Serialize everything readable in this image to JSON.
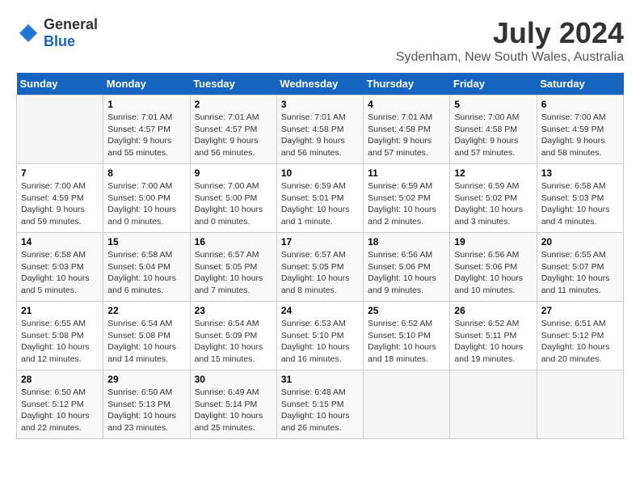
{
  "header": {
    "logo_general": "General",
    "logo_blue": "Blue",
    "title": "July 2024",
    "subtitle": "Sydenham, New South Wales, Australia"
  },
  "calendar": {
    "weekdays": [
      "Sunday",
      "Monday",
      "Tuesday",
      "Wednesday",
      "Thursday",
      "Friday",
      "Saturday"
    ],
    "weeks": [
      [
        {
          "day": "",
          "sunrise": "",
          "sunset": "",
          "daylight": ""
        },
        {
          "day": "1",
          "sunrise": "Sunrise: 7:01 AM",
          "sunset": "Sunset: 4:57 PM",
          "daylight": "Daylight: 9 hours and 55 minutes."
        },
        {
          "day": "2",
          "sunrise": "Sunrise: 7:01 AM",
          "sunset": "Sunset: 4:57 PM",
          "daylight": "Daylight: 9 hours and 56 minutes."
        },
        {
          "day": "3",
          "sunrise": "Sunrise: 7:01 AM",
          "sunset": "Sunset: 4:58 PM",
          "daylight": "Daylight: 9 hours and 56 minutes."
        },
        {
          "day": "4",
          "sunrise": "Sunrise: 7:01 AM",
          "sunset": "Sunset: 4:58 PM",
          "daylight": "Daylight: 9 hours and 57 minutes."
        },
        {
          "day": "5",
          "sunrise": "Sunrise: 7:00 AM",
          "sunset": "Sunset: 4:58 PM",
          "daylight": "Daylight: 9 hours and 57 minutes."
        },
        {
          "day": "6",
          "sunrise": "Sunrise: 7:00 AM",
          "sunset": "Sunset: 4:59 PM",
          "daylight": "Daylight: 9 hours and 58 minutes."
        }
      ],
      [
        {
          "day": "7",
          "sunrise": "Sunrise: 7:00 AM",
          "sunset": "Sunset: 4:59 PM",
          "daylight": "Daylight: 9 hours and 59 minutes."
        },
        {
          "day": "8",
          "sunrise": "Sunrise: 7:00 AM",
          "sunset": "Sunset: 5:00 PM",
          "daylight": "Daylight: 10 hours and 0 minutes."
        },
        {
          "day": "9",
          "sunrise": "Sunrise: 7:00 AM",
          "sunset": "Sunset: 5:00 PM",
          "daylight": "Daylight: 10 hours and 0 minutes."
        },
        {
          "day": "10",
          "sunrise": "Sunrise: 6:59 AM",
          "sunset": "Sunset: 5:01 PM",
          "daylight": "Daylight: 10 hours and 1 minute."
        },
        {
          "day": "11",
          "sunrise": "Sunrise: 6:59 AM",
          "sunset": "Sunset: 5:02 PM",
          "daylight": "Daylight: 10 hours and 2 minutes."
        },
        {
          "day": "12",
          "sunrise": "Sunrise: 6:59 AM",
          "sunset": "Sunset: 5:02 PM",
          "daylight": "Daylight: 10 hours and 3 minutes."
        },
        {
          "day": "13",
          "sunrise": "Sunrise: 6:58 AM",
          "sunset": "Sunset: 5:03 PM",
          "daylight": "Daylight: 10 hours and 4 minutes."
        }
      ],
      [
        {
          "day": "14",
          "sunrise": "Sunrise: 6:58 AM",
          "sunset": "Sunset: 5:03 PM",
          "daylight": "Daylight: 10 hours and 5 minutes."
        },
        {
          "day": "15",
          "sunrise": "Sunrise: 6:58 AM",
          "sunset": "Sunset: 5:04 PM",
          "daylight": "Daylight: 10 hours and 6 minutes."
        },
        {
          "day": "16",
          "sunrise": "Sunrise: 6:57 AM",
          "sunset": "Sunset: 5:05 PM",
          "daylight": "Daylight: 10 hours and 7 minutes."
        },
        {
          "day": "17",
          "sunrise": "Sunrise: 6:57 AM",
          "sunset": "Sunset: 5:05 PM",
          "daylight": "Daylight: 10 hours and 8 minutes."
        },
        {
          "day": "18",
          "sunrise": "Sunrise: 6:56 AM",
          "sunset": "Sunset: 5:06 PM",
          "daylight": "Daylight: 10 hours and 9 minutes."
        },
        {
          "day": "19",
          "sunrise": "Sunrise: 6:56 AM",
          "sunset": "Sunset: 5:06 PM",
          "daylight": "Daylight: 10 hours and 10 minutes."
        },
        {
          "day": "20",
          "sunrise": "Sunrise: 6:55 AM",
          "sunset": "Sunset: 5:07 PM",
          "daylight": "Daylight: 10 hours and 11 minutes."
        }
      ],
      [
        {
          "day": "21",
          "sunrise": "Sunrise: 6:55 AM",
          "sunset": "Sunset: 5:08 PM",
          "daylight": "Daylight: 10 hours and 12 minutes."
        },
        {
          "day": "22",
          "sunrise": "Sunrise: 6:54 AM",
          "sunset": "Sunset: 5:08 PM",
          "daylight": "Daylight: 10 hours and 14 minutes."
        },
        {
          "day": "23",
          "sunrise": "Sunrise: 6:54 AM",
          "sunset": "Sunset: 5:09 PM",
          "daylight": "Daylight: 10 hours and 15 minutes."
        },
        {
          "day": "24",
          "sunrise": "Sunrise: 6:53 AM",
          "sunset": "Sunset: 5:10 PM",
          "daylight": "Daylight: 10 hours and 16 minutes."
        },
        {
          "day": "25",
          "sunrise": "Sunrise: 6:52 AM",
          "sunset": "Sunset: 5:10 PM",
          "daylight": "Daylight: 10 hours and 18 minutes."
        },
        {
          "day": "26",
          "sunrise": "Sunrise: 6:52 AM",
          "sunset": "Sunset: 5:11 PM",
          "daylight": "Daylight: 10 hours and 19 minutes."
        },
        {
          "day": "27",
          "sunrise": "Sunrise: 6:51 AM",
          "sunset": "Sunset: 5:12 PM",
          "daylight": "Daylight: 10 hours and 20 minutes."
        }
      ],
      [
        {
          "day": "28",
          "sunrise": "Sunrise: 6:50 AM",
          "sunset": "Sunset: 5:12 PM",
          "daylight": "Daylight: 10 hours and 22 minutes."
        },
        {
          "day": "29",
          "sunrise": "Sunrise: 6:50 AM",
          "sunset": "Sunset: 5:13 PM",
          "daylight": "Daylight: 10 hours and 23 minutes."
        },
        {
          "day": "30",
          "sunrise": "Sunrise: 6:49 AM",
          "sunset": "Sunset: 5:14 PM",
          "daylight": "Daylight: 10 hours and 25 minutes."
        },
        {
          "day": "31",
          "sunrise": "Sunrise: 6:48 AM",
          "sunset": "Sunset: 5:15 PM",
          "daylight": "Daylight: 10 hours and 26 minutes."
        },
        {
          "day": "",
          "sunrise": "",
          "sunset": "",
          "daylight": ""
        },
        {
          "day": "",
          "sunrise": "",
          "sunset": "",
          "daylight": ""
        },
        {
          "day": "",
          "sunrise": "",
          "sunset": "",
          "daylight": ""
        }
      ]
    ]
  }
}
